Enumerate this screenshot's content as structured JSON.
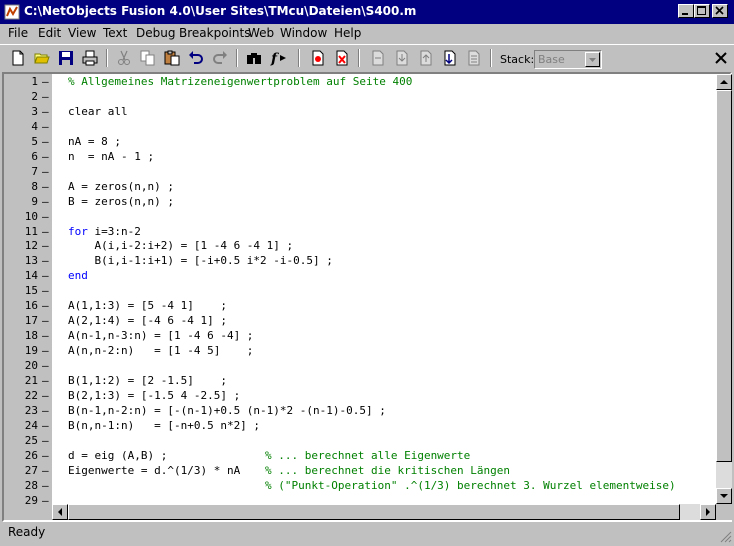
{
  "window": {
    "title": "C:\\NetObjects Fusion 4.0\\User Sites\\TMcu\\Dateien\\S400.m"
  },
  "menu": [
    "File",
    "Edit",
    "View",
    "Text",
    "Debug",
    "Breakpoints",
    "Web",
    "Window",
    "Help"
  ],
  "toolbar": {
    "stack_label": "Stack:",
    "stack_value": "Base",
    "buttons": [
      "new-file",
      "open-file",
      "save",
      "print",
      "cut",
      "copy",
      "paste",
      "undo",
      "redo",
      "find",
      "function",
      "set-breakpoint",
      "clear-breakpoints",
      "step",
      "step-in",
      "step-out",
      "continue",
      "exit-debug"
    ]
  },
  "editor": {
    "lines": [
      {
        "n": "1",
        "text": "% Allgemeines Matrizeneigenwertproblem auf Seite 400"
      },
      {
        "n": "2",
        "text": ""
      },
      {
        "n": "3",
        "text": "clear all"
      },
      {
        "n": "4",
        "text": ""
      },
      {
        "n": "5",
        "text": "nA = 8 ;"
      },
      {
        "n": "6",
        "text": "n  = nA - 1 ;"
      },
      {
        "n": "7",
        "text": ""
      },
      {
        "n": "8",
        "text": "A = zeros(n,n) ;"
      },
      {
        "n": "9",
        "text": "B = zeros(n,n) ;"
      },
      {
        "n": "10",
        "text": ""
      },
      {
        "n": "11",
        "text": "i=3:n-2",
        "kw": "for"
      },
      {
        "n": "12",
        "text": "    A(i,i-2:i+2) = [1 -4 6 -4 1] ;"
      },
      {
        "n": "13",
        "text": "    B(i,i-1:i+1) = [-i+0.5 i*2 -i-0.5] ;"
      },
      {
        "n": "14",
        "text": "",
        "kw": "end"
      },
      {
        "n": "15",
        "text": ""
      },
      {
        "n": "16",
        "text": "A(1,1:3) = [5 -4 1]    ;"
      },
      {
        "n": "17",
        "text": "A(2,1:4) = [-4 6 -4 1] ;"
      },
      {
        "n": "18",
        "text": "A(n-1,n-3:n) = [1 -4 6 -4] ;"
      },
      {
        "n": "19",
        "text": "A(n,n-2:n)   = [1 -4 5]    ;"
      },
      {
        "n": "20",
        "text": ""
      },
      {
        "n": "21",
        "text": "B(1,1:2) = [2 -1.5]    ;"
      },
      {
        "n": "22",
        "text": "B(2,1:3) = [-1.5 4 -2.5] ;"
      },
      {
        "n": "23",
        "text": "B(n-1,n-2:n) = [-(n-1)+0.5 (n-1)*2 -(n-1)-0.5] ;"
      },
      {
        "n": "24",
        "text": "B(n,n-1:n)   = [-n+0.5 n*2] ;"
      },
      {
        "n": "25",
        "text": ""
      },
      {
        "n": "26",
        "text": "d = eig (A,B) ;",
        "comment": "% ... berechnet alle Eigenwerte"
      },
      {
        "n": "27",
        "text": "Eigenwerte = d.^(1/3) * nA",
        "comment": "% ... berechnet die kritischen Längen"
      },
      {
        "n": "28",
        "text": "",
        "comment": "% (\"Punkt-Operation\" .^(1/3) berechnet 3. Wurzel elementweise)"
      },
      {
        "n": "29",
        "text": ""
      }
    ]
  },
  "status": {
    "text": "Ready"
  },
  "colors": {
    "titlebar": "#000080",
    "comment": "#008000",
    "keyword": "#0000ff",
    "chrome": "#c0c0c0"
  }
}
